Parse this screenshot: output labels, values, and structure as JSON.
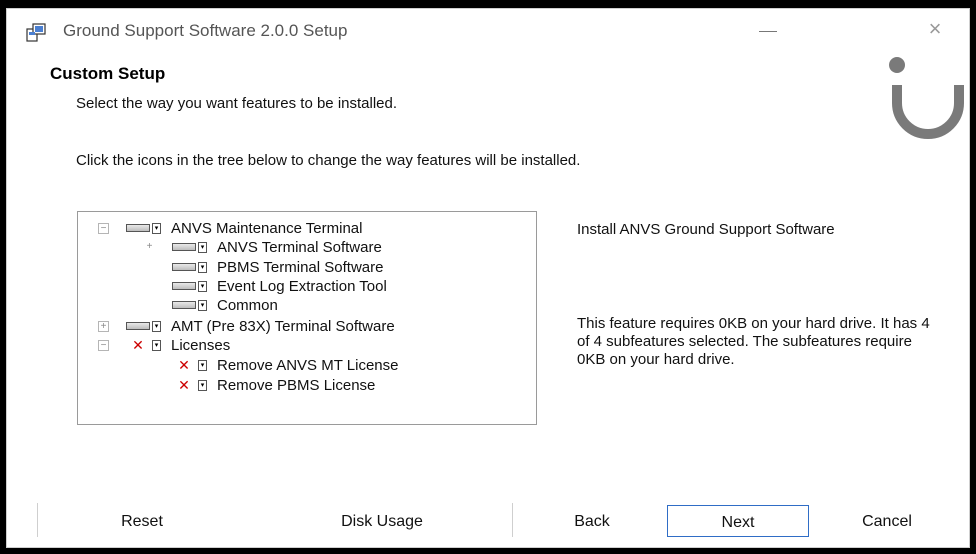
{
  "window": {
    "title": "Ground Support Software 2.0.0 Setup",
    "close_glyph": "×"
  },
  "header": {
    "title": "Custom Setup",
    "subtitle": "Select the way you want features to be installed."
  },
  "instruction": "Click the icons in the tree below to change the way features will be installed.",
  "tree": [
    {
      "label": "ANVS Maintenance Terminal",
      "expander": "−",
      "state": "installed"
    },
    {
      "label": "ANVS Terminal Software",
      "expander": "+",
      "state": "installed"
    },
    {
      "label": "PBMS Terminal Software",
      "state": "installed"
    },
    {
      "label": "Event Log Extraction Tool",
      "state": "installed"
    },
    {
      "label": "Common",
      "state": "installed"
    },
    {
      "label": "AMT (Pre 83X) Terminal Software",
      "expander": "+",
      "state": "installed"
    },
    {
      "label": "Licenses",
      "expander": "−",
      "state": "not-installed"
    },
    {
      "label": "Remove ANVS MT License",
      "state": "not-installed"
    },
    {
      "label": "Remove PBMS License",
      "state": "not-installed"
    }
  ],
  "description": {
    "feature_desc": "Install ANVS Ground Support Software",
    "requirements": "This feature requires 0KB on your hard drive. It has 4 of 4 subfeatures selected. The subfeatures require 0KB on your hard drive."
  },
  "buttons": {
    "reset": "Reset",
    "disk_usage": "Disk Usage",
    "back": "Back",
    "next": "Next",
    "cancel": "Cancel"
  },
  "colors": {
    "accent_border": "#2f6dc6",
    "unavailable_mark": "#cc0000"
  }
}
